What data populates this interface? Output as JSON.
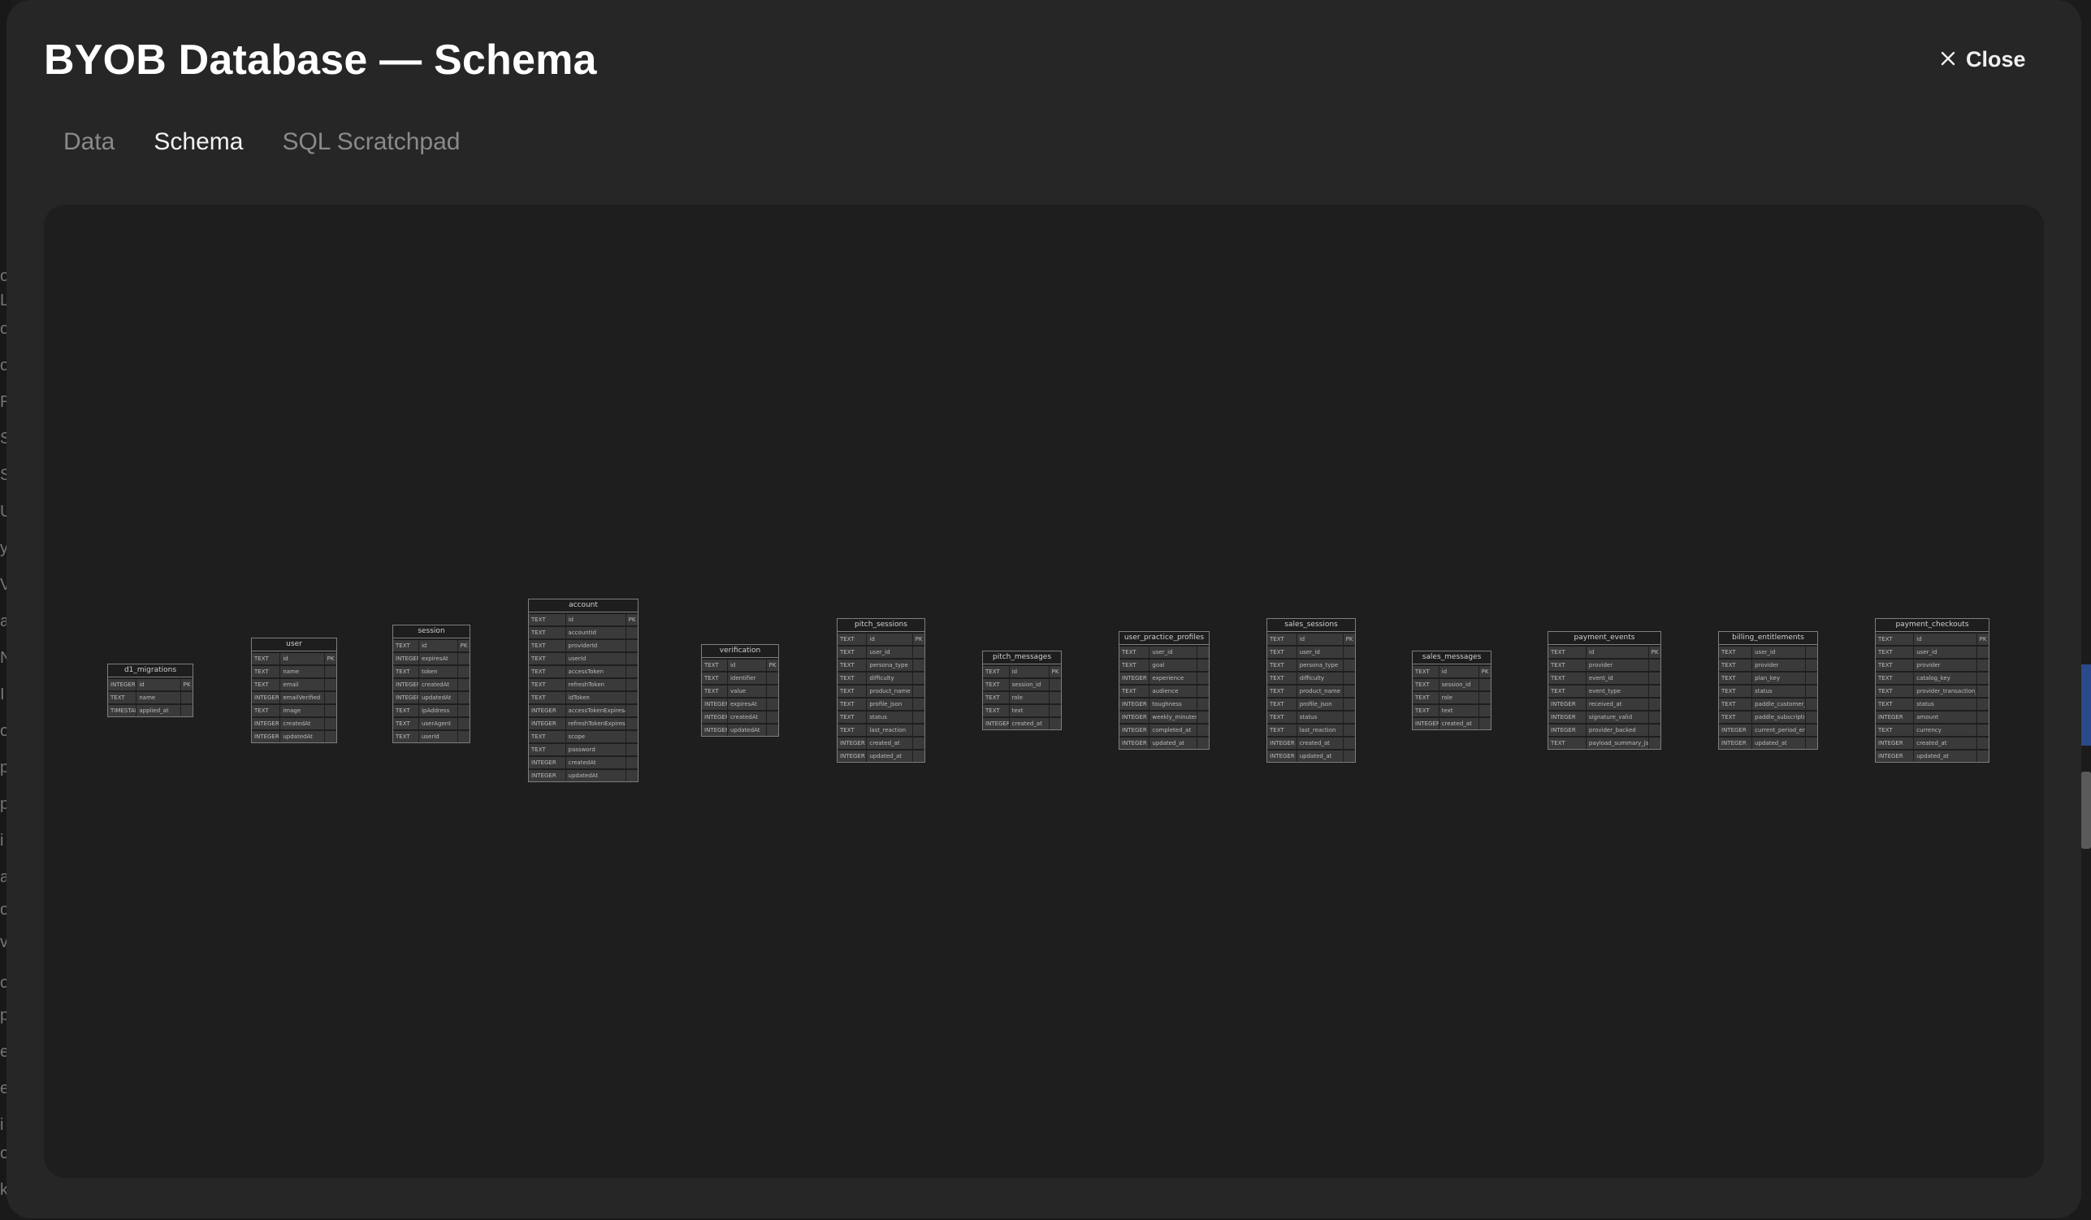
{
  "modal": {
    "title": "BYOB Database — Schema",
    "close_label": "Close",
    "close_icon": "x-icon"
  },
  "tabs": [
    {
      "label": "Data",
      "active": false
    },
    {
      "label": "Schema",
      "active": true
    },
    {
      "label": "SQL Scratchpad",
      "active": false
    }
  ],
  "schema": {
    "tables": [
      {
        "name": "d1_migrations",
        "columns": [
          {
            "type": "INTEGER",
            "name": "id",
            "key": "PK"
          },
          {
            "type": "TEXT",
            "name": "name",
            "key": ""
          },
          {
            "type": "TIMESTAMP",
            "name": "applied_at",
            "key": ""
          }
        ]
      },
      {
        "name": "user",
        "columns": [
          {
            "type": "TEXT",
            "name": "id",
            "key": "PK"
          },
          {
            "type": "TEXT",
            "name": "name",
            "key": ""
          },
          {
            "type": "TEXT",
            "name": "email",
            "key": ""
          },
          {
            "type": "INTEGER",
            "name": "emailVerified",
            "key": ""
          },
          {
            "type": "TEXT",
            "name": "image",
            "key": ""
          },
          {
            "type": "INTEGER",
            "name": "createdAt",
            "key": ""
          },
          {
            "type": "INTEGER",
            "name": "updatedAt",
            "key": ""
          }
        ]
      },
      {
        "name": "session",
        "columns": [
          {
            "type": "TEXT",
            "name": "id",
            "key": "PK"
          },
          {
            "type": "INTEGER",
            "name": "expiresAt",
            "key": ""
          },
          {
            "type": "TEXT",
            "name": "token",
            "key": ""
          },
          {
            "type": "INTEGER",
            "name": "createdAt",
            "key": ""
          },
          {
            "type": "INTEGER",
            "name": "updatedAt",
            "key": ""
          },
          {
            "type": "TEXT",
            "name": "ipAddress",
            "key": ""
          },
          {
            "type": "TEXT",
            "name": "userAgent",
            "key": ""
          },
          {
            "type": "TEXT",
            "name": "userId",
            "key": ""
          }
        ]
      },
      {
        "name": "account",
        "columns": [
          {
            "type": "TEXT",
            "name": "id",
            "key": "PK"
          },
          {
            "type": "TEXT",
            "name": "accountId",
            "key": ""
          },
          {
            "type": "TEXT",
            "name": "providerId",
            "key": ""
          },
          {
            "type": "TEXT",
            "name": "userId",
            "key": ""
          },
          {
            "type": "TEXT",
            "name": "accessToken",
            "key": ""
          },
          {
            "type": "TEXT",
            "name": "refreshToken",
            "key": ""
          },
          {
            "type": "TEXT",
            "name": "idToken",
            "key": ""
          },
          {
            "type": "INTEGER",
            "name": "accessTokenExpiresAt",
            "key": ""
          },
          {
            "type": "INTEGER",
            "name": "refreshTokenExpiresAt",
            "key": ""
          },
          {
            "type": "TEXT",
            "name": "scope",
            "key": ""
          },
          {
            "type": "TEXT",
            "name": "password",
            "key": ""
          },
          {
            "type": "INTEGER",
            "name": "createdAt",
            "key": ""
          },
          {
            "type": "INTEGER",
            "name": "updatedAt",
            "key": ""
          }
        ]
      },
      {
        "name": "verification",
        "columns": [
          {
            "type": "TEXT",
            "name": "id",
            "key": "PK"
          },
          {
            "type": "TEXT",
            "name": "identifier",
            "key": ""
          },
          {
            "type": "TEXT",
            "name": "value",
            "key": ""
          },
          {
            "type": "INTEGER",
            "name": "expiresAt",
            "key": ""
          },
          {
            "type": "INTEGER",
            "name": "createdAt",
            "key": ""
          },
          {
            "type": "INTEGER",
            "name": "updatedAt",
            "key": ""
          }
        ]
      },
      {
        "name": "pitch_sessions",
        "columns": [
          {
            "type": "TEXT",
            "name": "id",
            "key": "PK"
          },
          {
            "type": "TEXT",
            "name": "user_id",
            "key": ""
          },
          {
            "type": "TEXT",
            "name": "persona_type",
            "key": ""
          },
          {
            "type": "TEXT",
            "name": "difficulty",
            "key": ""
          },
          {
            "type": "TEXT",
            "name": "product_name",
            "key": ""
          },
          {
            "type": "TEXT",
            "name": "profile_json",
            "key": ""
          },
          {
            "type": "TEXT",
            "name": "status",
            "key": ""
          },
          {
            "type": "TEXT",
            "name": "last_reaction",
            "key": ""
          },
          {
            "type": "INTEGER",
            "name": "created_at",
            "key": ""
          },
          {
            "type": "INTEGER",
            "name": "updated_at",
            "key": ""
          }
        ]
      },
      {
        "name": "pitch_messages",
        "columns": [
          {
            "type": "TEXT",
            "name": "id",
            "key": "PK"
          },
          {
            "type": "TEXT",
            "name": "session_id",
            "key": ""
          },
          {
            "type": "TEXT",
            "name": "role",
            "key": ""
          },
          {
            "type": "TEXT",
            "name": "text",
            "key": ""
          },
          {
            "type": "INTEGER",
            "name": "created_at",
            "key": ""
          }
        ]
      },
      {
        "name": "user_practice_profiles",
        "columns": [
          {
            "type": "TEXT",
            "name": "user_id",
            "key": ""
          },
          {
            "type": "TEXT",
            "name": "goal",
            "key": ""
          },
          {
            "type": "INTEGER",
            "name": "experience",
            "key": ""
          },
          {
            "type": "TEXT",
            "name": "audience",
            "key": ""
          },
          {
            "type": "INTEGER",
            "name": "toughness",
            "key": ""
          },
          {
            "type": "INTEGER",
            "name": "weekly_minutes",
            "key": ""
          },
          {
            "type": "INTEGER",
            "name": "completed_at",
            "key": ""
          },
          {
            "type": "INTEGER",
            "name": "updated_at",
            "key": ""
          }
        ]
      },
      {
        "name": "sales_sessions",
        "columns": [
          {
            "type": "TEXT",
            "name": "id",
            "key": "PK"
          },
          {
            "type": "TEXT",
            "name": "user_id",
            "key": ""
          },
          {
            "type": "TEXT",
            "name": "persona_type",
            "key": ""
          },
          {
            "type": "TEXT",
            "name": "difficulty",
            "key": ""
          },
          {
            "type": "TEXT",
            "name": "product_name",
            "key": ""
          },
          {
            "type": "TEXT",
            "name": "profile_json",
            "key": ""
          },
          {
            "type": "TEXT",
            "name": "status",
            "key": ""
          },
          {
            "type": "TEXT",
            "name": "last_reaction",
            "key": ""
          },
          {
            "type": "INTEGER",
            "name": "created_at",
            "key": ""
          },
          {
            "type": "INTEGER",
            "name": "updated_at",
            "key": ""
          }
        ]
      },
      {
        "name": "sales_messages",
        "columns": [
          {
            "type": "TEXT",
            "name": "id",
            "key": "PK"
          },
          {
            "type": "TEXT",
            "name": "session_id",
            "key": ""
          },
          {
            "type": "TEXT",
            "name": "role",
            "key": ""
          },
          {
            "type": "TEXT",
            "name": "text",
            "key": ""
          },
          {
            "type": "INTEGER",
            "name": "created_at",
            "key": ""
          }
        ]
      },
      {
        "name": "payment_events",
        "columns": [
          {
            "type": "TEXT",
            "name": "id",
            "key": "PK"
          },
          {
            "type": "TEXT",
            "name": "provider",
            "key": ""
          },
          {
            "type": "TEXT",
            "name": "event_id",
            "key": ""
          },
          {
            "type": "TEXT",
            "name": "event_type",
            "key": ""
          },
          {
            "type": "INTEGER",
            "name": "received_at",
            "key": ""
          },
          {
            "type": "INTEGER",
            "name": "signature_valid",
            "key": ""
          },
          {
            "type": "INTEGER",
            "name": "provider_backed",
            "key": ""
          },
          {
            "type": "TEXT",
            "name": "payload_summary_json",
            "key": ""
          }
        ]
      },
      {
        "name": "billing_entitlements",
        "columns": [
          {
            "type": "TEXT",
            "name": "user_id",
            "key": ""
          },
          {
            "type": "TEXT",
            "name": "provider",
            "key": ""
          },
          {
            "type": "TEXT",
            "name": "plan_key",
            "key": ""
          },
          {
            "type": "TEXT",
            "name": "status",
            "key": ""
          },
          {
            "type": "TEXT",
            "name": "paddle_customer_id",
            "key": ""
          },
          {
            "type": "TEXT",
            "name": "paddle_subscription_id",
            "key": ""
          },
          {
            "type": "INTEGER",
            "name": "current_period_end",
            "key": ""
          },
          {
            "type": "INTEGER",
            "name": "updated_at",
            "key": ""
          }
        ]
      },
      {
        "name": "payment_checkouts",
        "columns": [
          {
            "type": "TEXT",
            "name": "id",
            "key": "PK"
          },
          {
            "type": "TEXT",
            "name": "user_id",
            "key": ""
          },
          {
            "type": "TEXT",
            "name": "provider",
            "key": ""
          },
          {
            "type": "TEXT",
            "name": "catalog_key",
            "key": ""
          },
          {
            "type": "TEXT",
            "name": "provider_transaction_id",
            "key": ""
          },
          {
            "type": "TEXT",
            "name": "status",
            "key": ""
          },
          {
            "type": "INTEGER",
            "name": "amount",
            "key": ""
          },
          {
            "type": "TEXT",
            "name": "currency",
            "key": ""
          },
          {
            "type": "INTEGER",
            "name": "created_at",
            "key": ""
          },
          {
            "type": "INTEGER",
            "name": "updated_at",
            "key": ""
          }
        ]
      }
    ]
  }
}
